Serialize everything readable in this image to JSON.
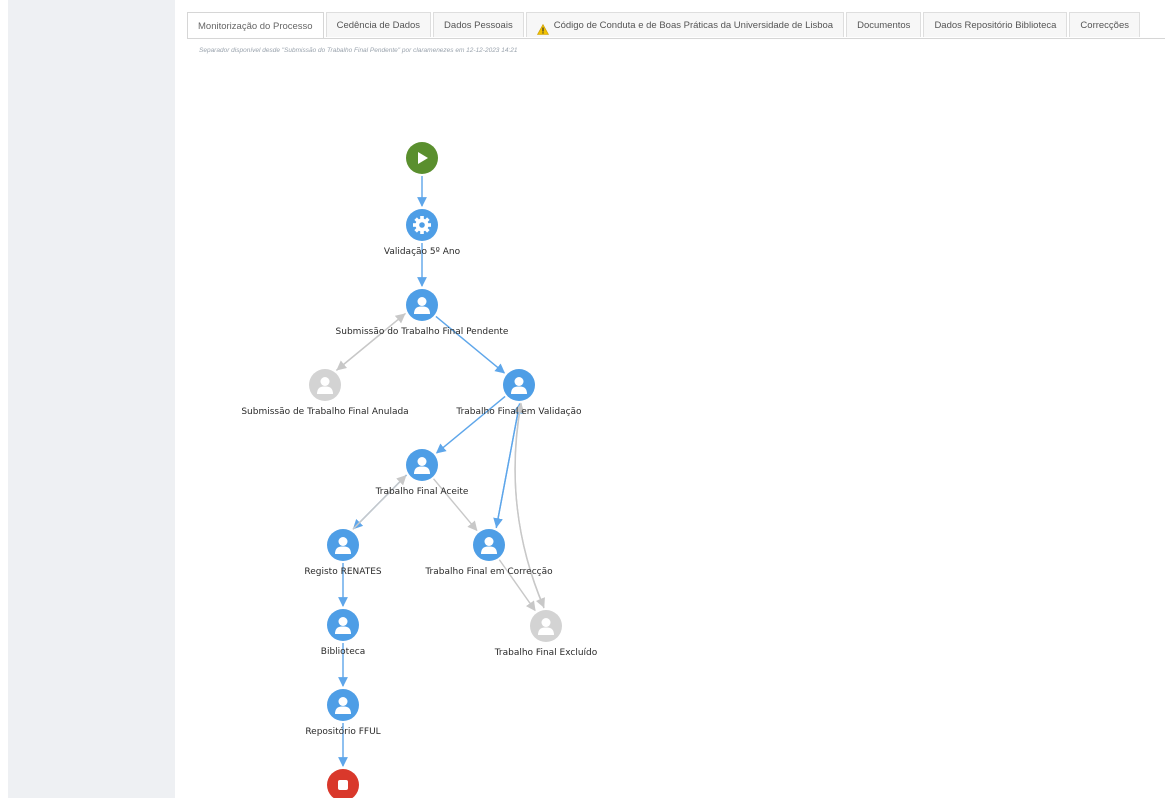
{
  "tabs": [
    {
      "label": "Monitorização do Processo",
      "active": true
    },
    {
      "label": "Cedência de Dados"
    },
    {
      "label": "Dados Pessoais"
    },
    {
      "label": "Código de Conduta e de Boas Práticas da Universidade de Lisboa",
      "icon": "warning-icon"
    },
    {
      "label": "Documentos"
    },
    {
      "label": "Dados Repositório Biblioteca"
    },
    {
      "label": "Correcções"
    }
  ],
  "note": "Separador disponível desde \"Submissão do Trabalho Final Pendente\" por claramenezes em 12-12-2023 14:21",
  "colors": {
    "active_node": "#4e9ee6",
    "inactive_node": "#d3d3d3",
    "start_node": "#5a8f2e",
    "end_node": "#d9382b",
    "active_edge": "#5ea6ea",
    "inactive_edge": "#c8c8c8"
  },
  "workflow": {
    "nodes": {
      "start": {
        "kind": "start",
        "icon": "play-icon",
        "label": ""
      },
      "validacao": {
        "kind": "active",
        "icon": "gear-icon",
        "label": "Validação 5º Ano"
      },
      "submissao": {
        "kind": "active",
        "icon": "user-icon",
        "label": "Submissão do Trabalho Final Pendente"
      },
      "anulada": {
        "kind": "inactive",
        "icon": "user-icon",
        "label": "Submissão de Trabalho Final Anulada"
      },
      "validacao_final": {
        "kind": "active",
        "icon": "user-icon",
        "label": "Trabalho Final em Validação"
      },
      "aceite": {
        "kind": "active",
        "icon": "user-icon",
        "label": "Trabalho Final Aceite"
      },
      "renates": {
        "kind": "active",
        "icon": "user-icon",
        "label": "Registo RENATES"
      },
      "correccao": {
        "kind": "active",
        "icon": "user-icon",
        "label": "Trabalho Final em Correcção"
      },
      "excluido": {
        "kind": "inactive",
        "icon": "user-icon",
        "label": "Trabalho Final Excluído"
      },
      "biblioteca": {
        "kind": "active",
        "icon": "user-icon",
        "label": "Biblioteca"
      },
      "repositorio": {
        "kind": "active",
        "icon": "user-icon",
        "label": "Repositório FFUL"
      },
      "end": {
        "kind": "end",
        "icon": "stop-icon",
        "label": ""
      }
    },
    "edges": [
      {
        "from": "start",
        "to": "validacao",
        "state": "active"
      },
      {
        "from": "validacao",
        "to": "submissao",
        "state": "active"
      },
      {
        "from": "submissao",
        "to": "anulada",
        "state": "inactive"
      },
      {
        "from": "anulada",
        "to": "submissao",
        "state": "inactive"
      },
      {
        "from": "submissao",
        "to": "validacao_final",
        "state": "active"
      },
      {
        "from": "validacao_final",
        "to": "aceite",
        "state": "active"
      },
      {
        "from": "validacao_final",
        "to": "correccao",
        "state": "active"
      },
      {
        "from": "correccao",
        "to": "validacao_final",
        "state": "active"
      },
      {
        "from": "validacao_final",
        "to": "excluido",
        "state": "inactive"
      },
      {
        "from": "excluido",
        "to": "validacao_final",
        "state": "inactive"
      },
      {
        "from": "aceite",
        "to": "renates",
        "state": "active"
      },
      {
        "from": "renates",
        "to": "aceite",
        "state": "inactive"
      },
      {
        "from": "aceite",
        "to": "correccao",
        "state": "inactive"
      },
      {
        "from": "correccao",
        "to": "excluido",
        "state": "inactive"
      },
      {
        "from": "renates",
        "to": "biblioteca",
        "state": "active"
      },
      {
        "from": "biblioteca",
        "to": "repositorio",
        "state": "active"
      },
      {
        "from": "repositorio",
        "to": "end",
        "state": "active"
      }
    ]
  }
}
